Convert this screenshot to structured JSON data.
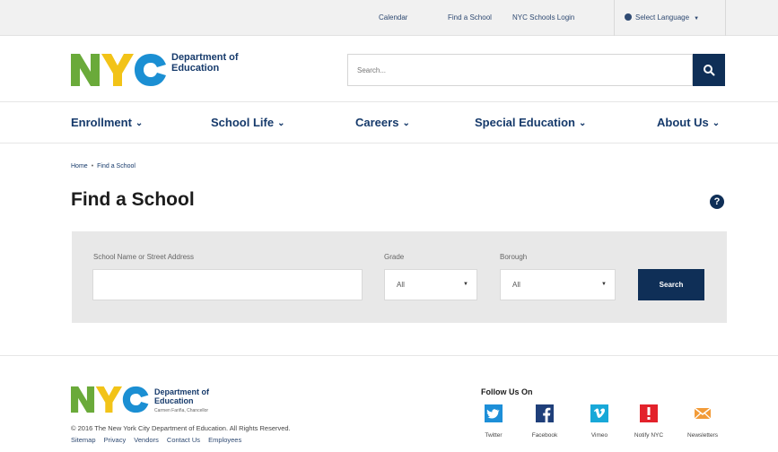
{
  "utility_bar": {
    "links": [
      "Calendar",
      "Find a School",
      "NYC Schools Login"
    ],
    "language_label": "Select Language"
  },
  "header": {
    "logo_text_line1": "Department of",
    "logo_text_line2": "Education",
    "search_placeholder": "Search..."
  },
  "nav": {
    "items": [
      "Enrollment",
      "School Life",
      "Careers",
      "Special Education",
      "About Us"
    ]
  },
  "breadcrumb": {
    "home": "Home",
    "separator": "•",
    "current": "Find a School"
  },
  "page": {
    "title": "Find a School",
    "help_glyph": "?"
  },
  "search_form": {
    "name_label": "School Name or Street Address",
    "grade_label": "Grade",
    "grade_value": "All",
    "borough_label": "Borough",
    "borough_value": "All",
    "button_label": "Search"
  },
  "footer": {
    "logo_text_line1": "Department of",
    "logo_text_line2": "Education",
    "logo_tagline": "Carmen Fariña, Chancellor",
    "copyright": "© 2016 The New York City Department of Education. All Rights Reserved.",
    "links": [
      "Sitemap",
      "Privacy",
      "Vendors",
      "Contact Us",
      "Employees"
    ],
    "follow_title": "Follow Us On",
    "social": [
      {
        "label": "Twitter",
        "icon": "twitter-icon",
        "color": "#1d8fd8"
      },
      {
        "label": "Facebook",
        "icon": "facebook-icon",
        "color": "#1f3f7a"
      },
      {
        "label": "Vimeo",
        "icon": "vimeo-icon",
        "color": "#18a8d8"
      },
      {
        "label": "Notify NYC",
        "icon": "notify-icon",
        "color": "#e3222b"
      },
      {
        "label": "Newsletters",
        "icon": "envelope-icon",
        "color": "#f29b38"
      }
    ]
  },
  "colors": {
    "brand_navy": "#0f2f57",
    "link_blue": "#163a6b",
    "logo_green": "#6aaa3a",
    "logo_yellow": "#f2c318",
    "logo_blue": "#1b8fd3"
  }
}
